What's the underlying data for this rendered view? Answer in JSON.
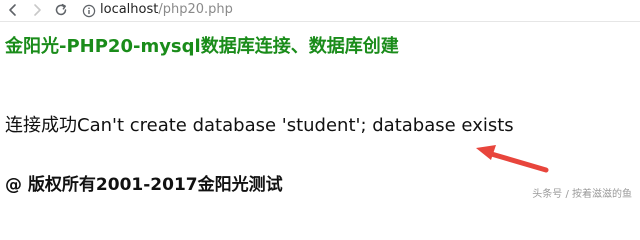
{
  "browser": {
    "url_host": "localhost",
    "url_path": "/php20.php"
  },
  "page": {
    "heading": "金阳光-PHP20-mysql数据库连接、数据库创建",
    "message": "连接成功Can't create database 'student'; database exists",
    "copyright": "@ 版权所有2001-2017金阳光测试"
  },
  "watermark": {
    "text": "头条号 / 按着滋滋的鱼"
  },
  "colors": {
    "heading": "#1a8c1a",
    "arrow": "#e8453c"
  },
  "icons": {
    "back": "arrow-left-icon",
    "forward": "arrow-right-icon",
    "reload": "reload-icon",
    "site_info": "info-circle-icon"
  }
}
